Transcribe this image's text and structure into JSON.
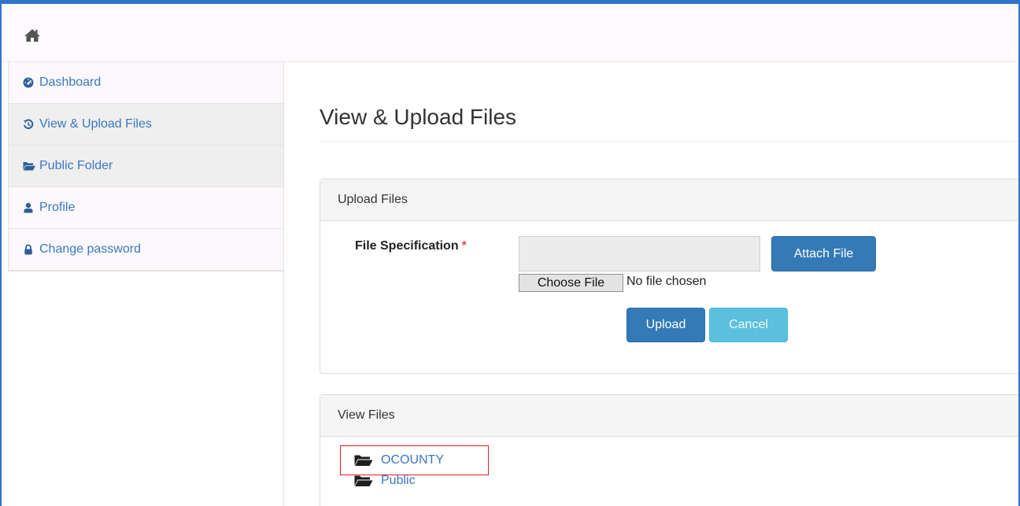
{
  "sidebar": {
    "items": [
      {
        "label": "Dashboard",
        "icon": "dashboard-icon"
      },
      {
        "label": "View & Upload Files",
        "icon": "history-icon"
      },
      {
        "label": "Public Folder",
        "icon": "folder-open-icon"
      },
      {
        "label": "Profile",
        "icon": "user-icon"
      },
      {
        "label": "Change password",
        "icon": "lock-icon"
      }
    ]
  },
  "main": {
    "title": "View & Upload Files",
    "upload_panel": {
      "heading": "Upload Files",
      "field_label": "File Specification",
      "required_marker": "*",
      "attach_label": "Attach File",
      "choose_label": "Choose File",
      "no_file_text": "No file chosen",
      "upload_label": "Upload",
      "cancel_label": "Cancel"
    },
    "view_panel": {
      "heading": "View Files",
      "folders": [
        {
          "name": "OCOUNTY"
        },
        {
          "name": "Public"
        }
      ]
    }
  },
  "colors": {
    "accent": "#2e75c9",
    "link": "#3a78c3",
    "primary": "#337ab7",
    "info": "#5bc0de",
    "required": "#d9534f",
    "highlight": "#e02020"
  }
}
